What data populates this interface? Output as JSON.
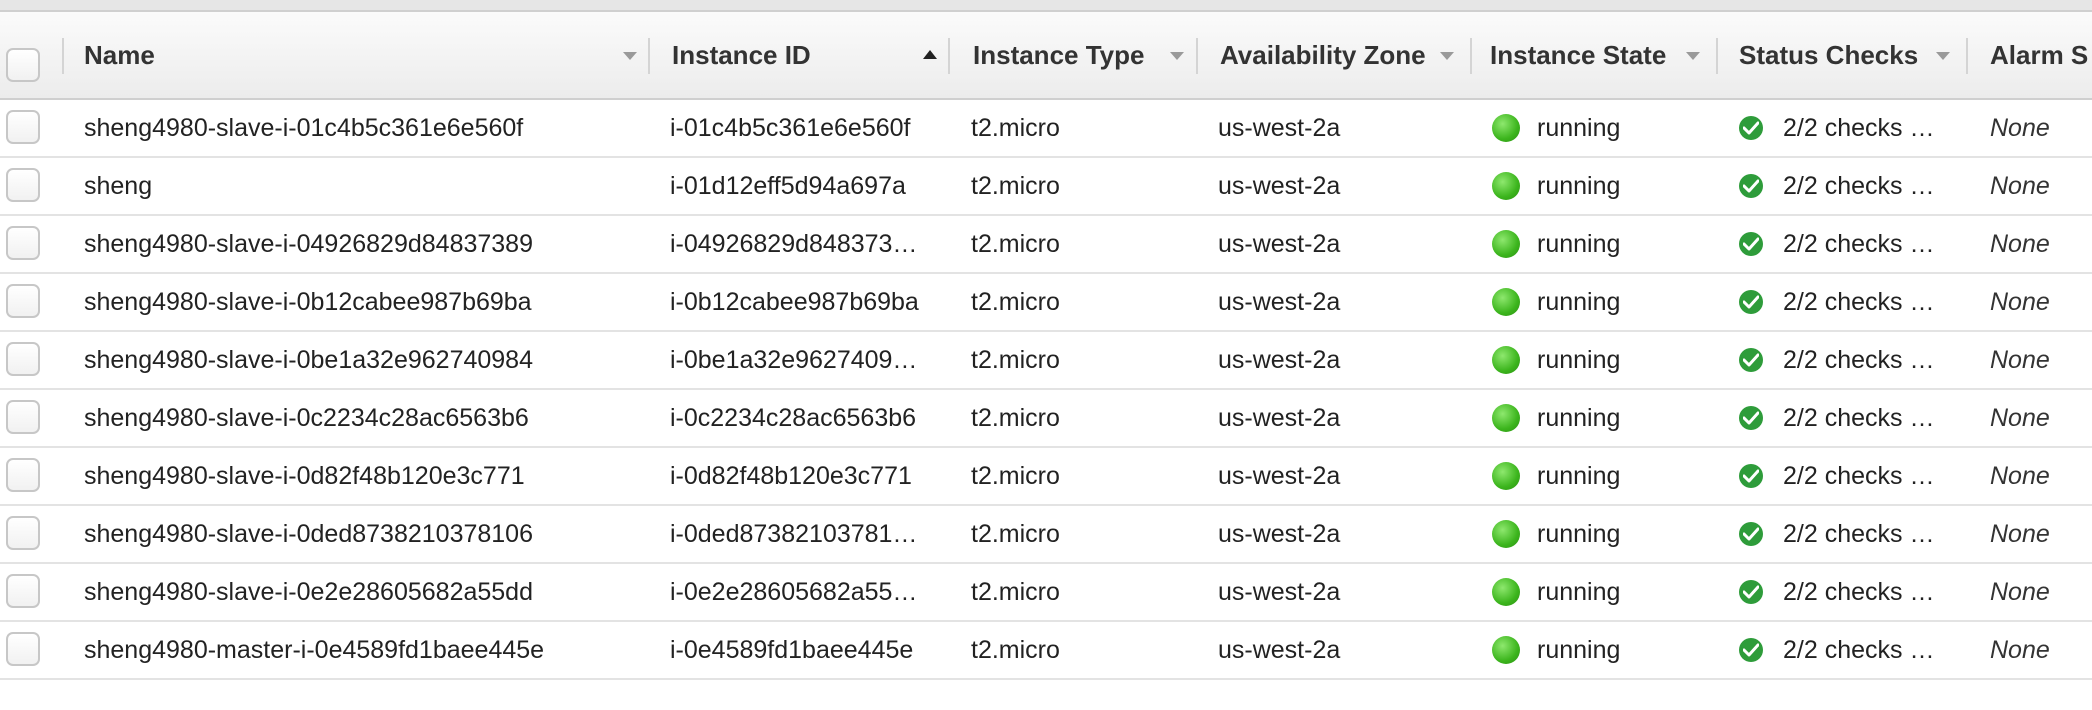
{
  "table": {
    "columns": [
      {
        "key": "name",
        "label": "Name",
        "sort": "none"
      },
      {
        "key": "instance_id",
        "label": "Instance ID",
        "sort": "asc"
      },
      {
        "key": "instance_type",
        "label": "Instance Type",
        "sort": "none"
      },
      {
        "key": "availability_zone",
        "label": "Availability Zone",
        "sort": "none"
      },
      {
        "key": "instance_state",
        "label": "Instance State",
        "sort": "none"
      },
      {
        "key": "status_checks",
        "label": "Status Checks",
        "sort": "none"
      },
      {
        "key": "alarm_status",
        "label": "Alarm S",
        "sort": "none"
      }
    ],
    "rows": [
      {
        "name": "sheng4980-slave-i-01c4b5c361e6e560f",
        "instance_id": "i-01c4b5c361e6e560f",
        "instance_type": "t2.micro",
        "availability_zone": "us-west-2a",
        "instance_state": "running",
        "status_checks": "2/2 checks …",
        "alarm_status": "None"
      },
      {
        "name": "sheng",
        "instance_id": "i-01d12eff5d94a697a",
        "instance_type": "t2.micro",
        "availability_zone": "us-west-2a",
        "instance_state": "running",
        "status_checks": "2/2 checks …",
        "alarm_status": "None"
      },
      {
        "name": "sheng4980-slave-i-04926829d84837389",
        "instance_id": "i-04926829d848373…",
        "instance_type": "t2.micro",
        "availability_zone": "us-west-2a",
        "instance_state": "running",
        "status_checks": "2/2 checks …",
        "alarm_status": "None"
      },
      {
        "name": "sheng4980-slave-i-0b12cabee987b69ba",
        "instance_id": "i-0b12cabee987b69ba",
        "instance_type": "t2.micro",
        "availability_zone": "us-west-2a",
        "instance_state": "running",
        "status_checks": "2/2 checks …",
        "alarm_status": "None"
      },
      {
        "name": "sheng4980-slave-i-0be1a32e962740984",
        "instance_id": "i-0be1a32e9627409…",
        "instance_type": "t2.micro",
        "availability_zone": "us-west-2a",
        "instance_state": "running",
        "status_checks": "2/2 checks …",
        "alarm_status": "None"
      },
      {
        "name": "sheng4980-slave-i-0c2234c28ac6563b6",
        "instance_id": "i-0c2234c28ac6563b6",
        "instance_type": "t2.micro",
        "availability_zone": "us-west-2a",
        "instance_state": "running",
        "status_checks": "2/2 checks …",
        "alarm_status": "None"
      },
      {
        "name": "sheng4980-slave-i-0d82f48b120e3c771",
        "instance_id": "i-0d82f48b120e3c771",
        "instance_type": "t2.micro",
        "availability_zone": "us-west-2a",
        "instance_state": "running",
        "status_checks": "2/2 checks …",
        "alarm_status": "None"
      },
      {
        "name": "sheng4980-slave-i-0ded8738210378106",
        "instance_id": "i-0ded87382103781…",
        "instance_type": "t2.micro",
        "availability_zone": "us-west-2a",
        "instance_state": "running",
        "status_checks": "2/2 checks …",
        "alarm_status": "None"
      },
      {
        "name": "sheng4980-slave-i-0e2e28605682a55dd",
        "instance_id": "i-0e2e28605682a55…",
        "instance_type": "t2.micro",
        "availability_zone": "us-west-2a",
        "instance_state": "running",
        "status_checks": "2/2 checks …",
        "alarm_status": "None"
      },
      {
        "name": "sheng4980-master-i-0e4589fd1baee445e",
        "instance_id": "i-0e4589fd1baee445e",
        "instance_type": "t2.micro",
        "availability_zone": "us-west-2a",
        "instance_state": "running",
        "status_checks": "2/2 checks …",
        "alarm_status": "None"
      }
    ]
  },
  "icons": {
    "state_running": "green-status-dot-icon",
    "checks_passed": "green-check-icon",
    "sort_asc": "sort-ascending-icon",
    "sort_menu": "chevron-down-icon"
  },
  "colors": {
    "running": "#3cb51d",
    "checks_passed": "#2e9c3a"
  }
}
